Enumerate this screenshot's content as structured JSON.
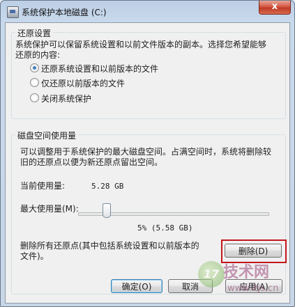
{
  "window": {
    "title": "系统保护本地磁盘 (C:)",
    "close_label": "x"
  },
  "restore_settings": {
    "legend": "还原设置",
    "description_line1": "系统保护可以保留系统设置和以前文件版本的副本。选择您希望能够",
    "description_line2": "还原的内容:",
    "options": [
      {
        "label": "还原系统设置和以前版本的文件",
        "checked": true
      },
      {
        "label": "仅还原以前版本的文件",
        "checked": false
      },
      {
        "label": "关闭系统保护",
        "checked": false
      }
    ]
  },
  "disk_usage": {
    "legend": "磁盘空间使用量",
    "description_line1": "可以调整用于系统保护的最大磁盘空间。占满空间时，系统将删除较",
    "description_line2": "旧的还原点以便为新还原点留出空间。",
    "current_usage_label": "当前使用量:",
    "current_usage_value": "5.28 GB",
    "max_usage_label": "最大使用量(M):",
    "slider_percent": 5,
    "max_usage_value": "5% (5.58 GB)",
    "delete_text_line1": "删除所有还原点(其中包括系统设置和以前版本的",
    "delete_text_line2": "文件)。",
    "delete_button": "删除(D)"
  },
  "footer": {
    "ok_button": "确定(O)",
    "cancel_button": "取消",
    "apply_button": "应用(A)"
  },
  "watermark": {
    "logo": "17",
    "brand": "技术网",
    "url": "www.itjs.cn"
  }
}
